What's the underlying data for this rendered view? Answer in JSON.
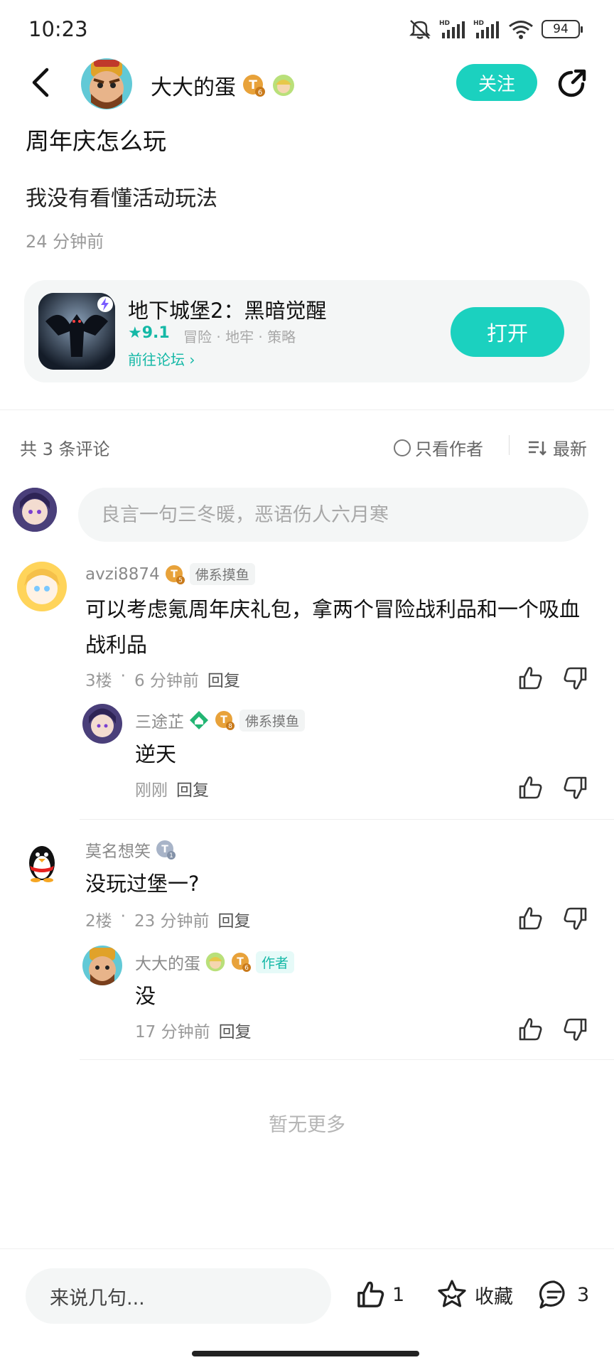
{
  "status_bar": {
    "time": "10:23",
    "battery": "94"
  },
  "header": {
    "author_name": "大大的蛋",
    "follow_label": "关注"
  },
  "post": {
    "title": "周年庆怎么玩",
    "body": "我没有看懂活动玩法",
    "time": "24 分钟前"
  },
  "game_card": {
    "name": "地下城堡2：黑暗觉醒",
    "rating": "★9.1",
    "tags": "冒险 · 地牢 · 策略",
    "forum_link": "前往论坛 ›",
    "open_label": "打开"
  },
  "comments_header": {
    "count": "共 3 条评论",
    "only_author": "只看作者",
    "sort": "最新"
  },
  "comment_input": {
    "placeholder": "良言一句三冬暖，恶语伤人六月寒"
  },
  "comments": [
    {
      "name": "avzi8874",
      "badge_level": "5",
      "tag": "佛系摸鱼",
      "text": "可以考虑氪周年庆礼包，拿两个冒险战利品和一个吸血战利品",
      "floor": "3楼",
      "time": "6 分钟前",
      "reply": "回复",
      "replies": [
        {
          "name": "三途芷",
          "badge_level": "8",
          "tag": "佛系摸鱼",
          "text": "逆天",
          "time": "刚刚",
          "reply": "回复"
        }
      ]
    },
    {
      "name": "莫名想笑",
      "badge_level": "1",
      "tag": "",
      "text": "没玩过堡一?",
      "floor": "2楼",
      "time": "23 分钟前",
      "reply": "回复",
      "replies": [
        {
          "name": "大大的蛋",
          "badge_level": "6",
          "tag": "作者",
          "text": "没",
          "time": "17 分钟前",
          "reply": "回复"
        }
      ]
    }
  ],
  "no_more": "暂无更多",
  "bottom_bar": {
    "input_label": "来说几句...",
    "like_count": "1",
    "collect_label": "收藏",
    "comment_count": "3"
  },
  "colors": {
    "accent": "#1bd1bf",
    "accent_text": "#14b8a6"
  }
}
